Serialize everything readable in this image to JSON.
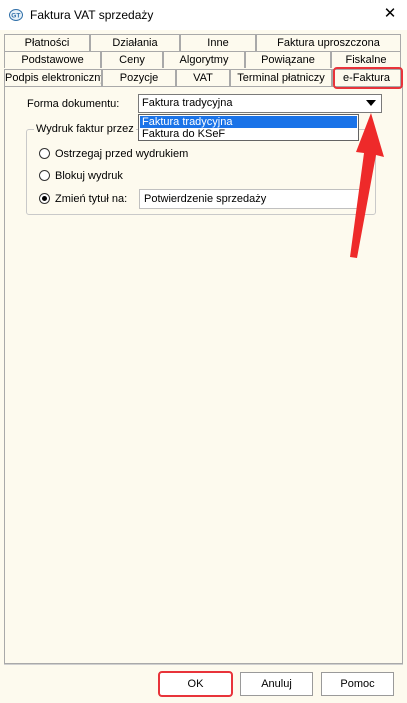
{
  "window": {
    "title": "Faktura VAT sprzedaży",
    "close_glyph": "✕",
    "icon": "app-logo-icon"
  },
  "tabs_row1": [
    "Płatności",
    "Działania",
    "Inne",
    "Faktura uproszczona"
  ],
  "tabs_row2": [
    "Podstawowe",
    "Ceny",
    "Algorytmy",
    "Powiązane",
    "Fiskalne"
  ],
  "tabs_row3": [
    "Podpis elektroniczny",
    "Pozycje",
    "VAT",
    "Terminal płatniczy",
    "e-Faktura"
  ],
  "active_tab": "e-Faktura",
  "form": {
    "document_form_label": "Forma dokumentu:",
    "document_form_value": "Faktura tradycyjna",
    "dropdown_options": [
      "Faktura tradycyjna",
      "Faktura do KSeF"
    ],
    "dropdown_selected_index": 0
  },
  "print_group": {
    "legend": "Wydruk faktur przez",
    "options": [
      "Ostrzegaj przed wydrukiem",
      "Blokuj wydruk",
      "Zmień tytuł na:"
    ],
    "selected_index": 2,
    "title_value": "Potwierdzenie sprzedaży"
  },
  "buttons": {
    "ok": "OK",
    "cancel": "Anuluj",
    "help": "Pomoc"
  },
  "colors": {
    "highlight": "#e8333a",
    "selection": "#1a73e8",
    "background": "#fdfaee"
  }
}
